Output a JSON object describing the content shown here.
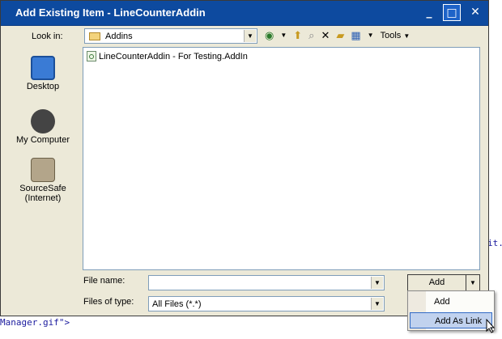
{
  "background": {
    "code_left": "Manager.gif\">",
    "code_right": "it."
  },
  "dialog": {
    "title": "Add Existing Item - LineCounterAddin",
    "buttons": {
      "minimize": "_",
      "maximize": "□",
      "close": "✕"
    }
  },
  "lookin": {
    "label": "Look in:",
    "value": "Addins",
    "tools_label": "Tools"
  },
  "places": [
    {
      "label": "Desktop",
      "icon": "desktop-icon"
    },
    {
      "label": "My Computer",
      "icon": "computer-icon"
    },
    {
      "label": "SourceSafe\n(Internet)",
      "icon": "sourcesafe-icon"
    }
  ],
  "files": [
    {
      "name": "LineCounterAddin - For Testing.AddIn",
      "icon": "addin-file-icon"
    }
  ],
  "filename": {
    "label": "File name:",
    "value": ""
  },
  "filetype": {
    "label": "Files of type:",
    "value": "All Files (*.*)"
  },
  "add_button": {
    "label": "Add"
  },
  "add_menu": {
    "items": [
      {
        "label": "Add"
      },
      {
        "label": "Add As Link"
      }
    ]
  },
  "colors": {
    "title_bar": "#0d4a9f",
    "dialog_bg": "#ece9d8",
    "menu_highlight": "#c1d2ee"
  }
}
